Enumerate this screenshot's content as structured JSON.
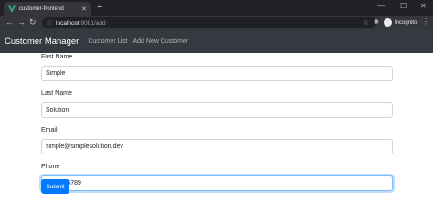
{
  "browser": {
    "tab": {
      "title": "customer-frontend"
    },
    "newtab_symbol": "+",
    "window_controls": {
      "minimize": "—",
      "maximize": "☐",
      "close": "✕"
    },
    "toolbar": {
      "back": "←",
      "forward": "→",
      "reload": "↻"
    },
    "url": {
      "host": "localhost",
      "path": ":8081/add"
    },
    "profile": {
      "label": "Incognito"
    },
    "icons": [
      "vue-favicon",
      "lock-icon",
      "star-icon",
      "extensions-icon",
      "incognito-icon",
      "menu-icon"
    ]
  },
  "navbar": {
    "brand": "Customer Manager",
    "links": [
      "Customer List",
      "Add New Customer"
    ]
  },
  "form": {
    "fields": [
      {
        "label": "First Name",
        "value": "Simple"
      },
      {
        "label": "Last Name",
        "value": "Solution"
      },
      {
        "label": "Email",
        "value": "simple@simplesolution.dev"
      },
      {
        "label": "Phone",
        "value": "0123456789",
        "focused": true
      }
    ],
    "submit_label": "Submit"
  },
  "colors": {
    "navbar_bg": "#343a40",
    "primary": "#007bff",
    "chrome_dark": "#202124",
    "chrome_toolbar": "#35363a"
  }
}
